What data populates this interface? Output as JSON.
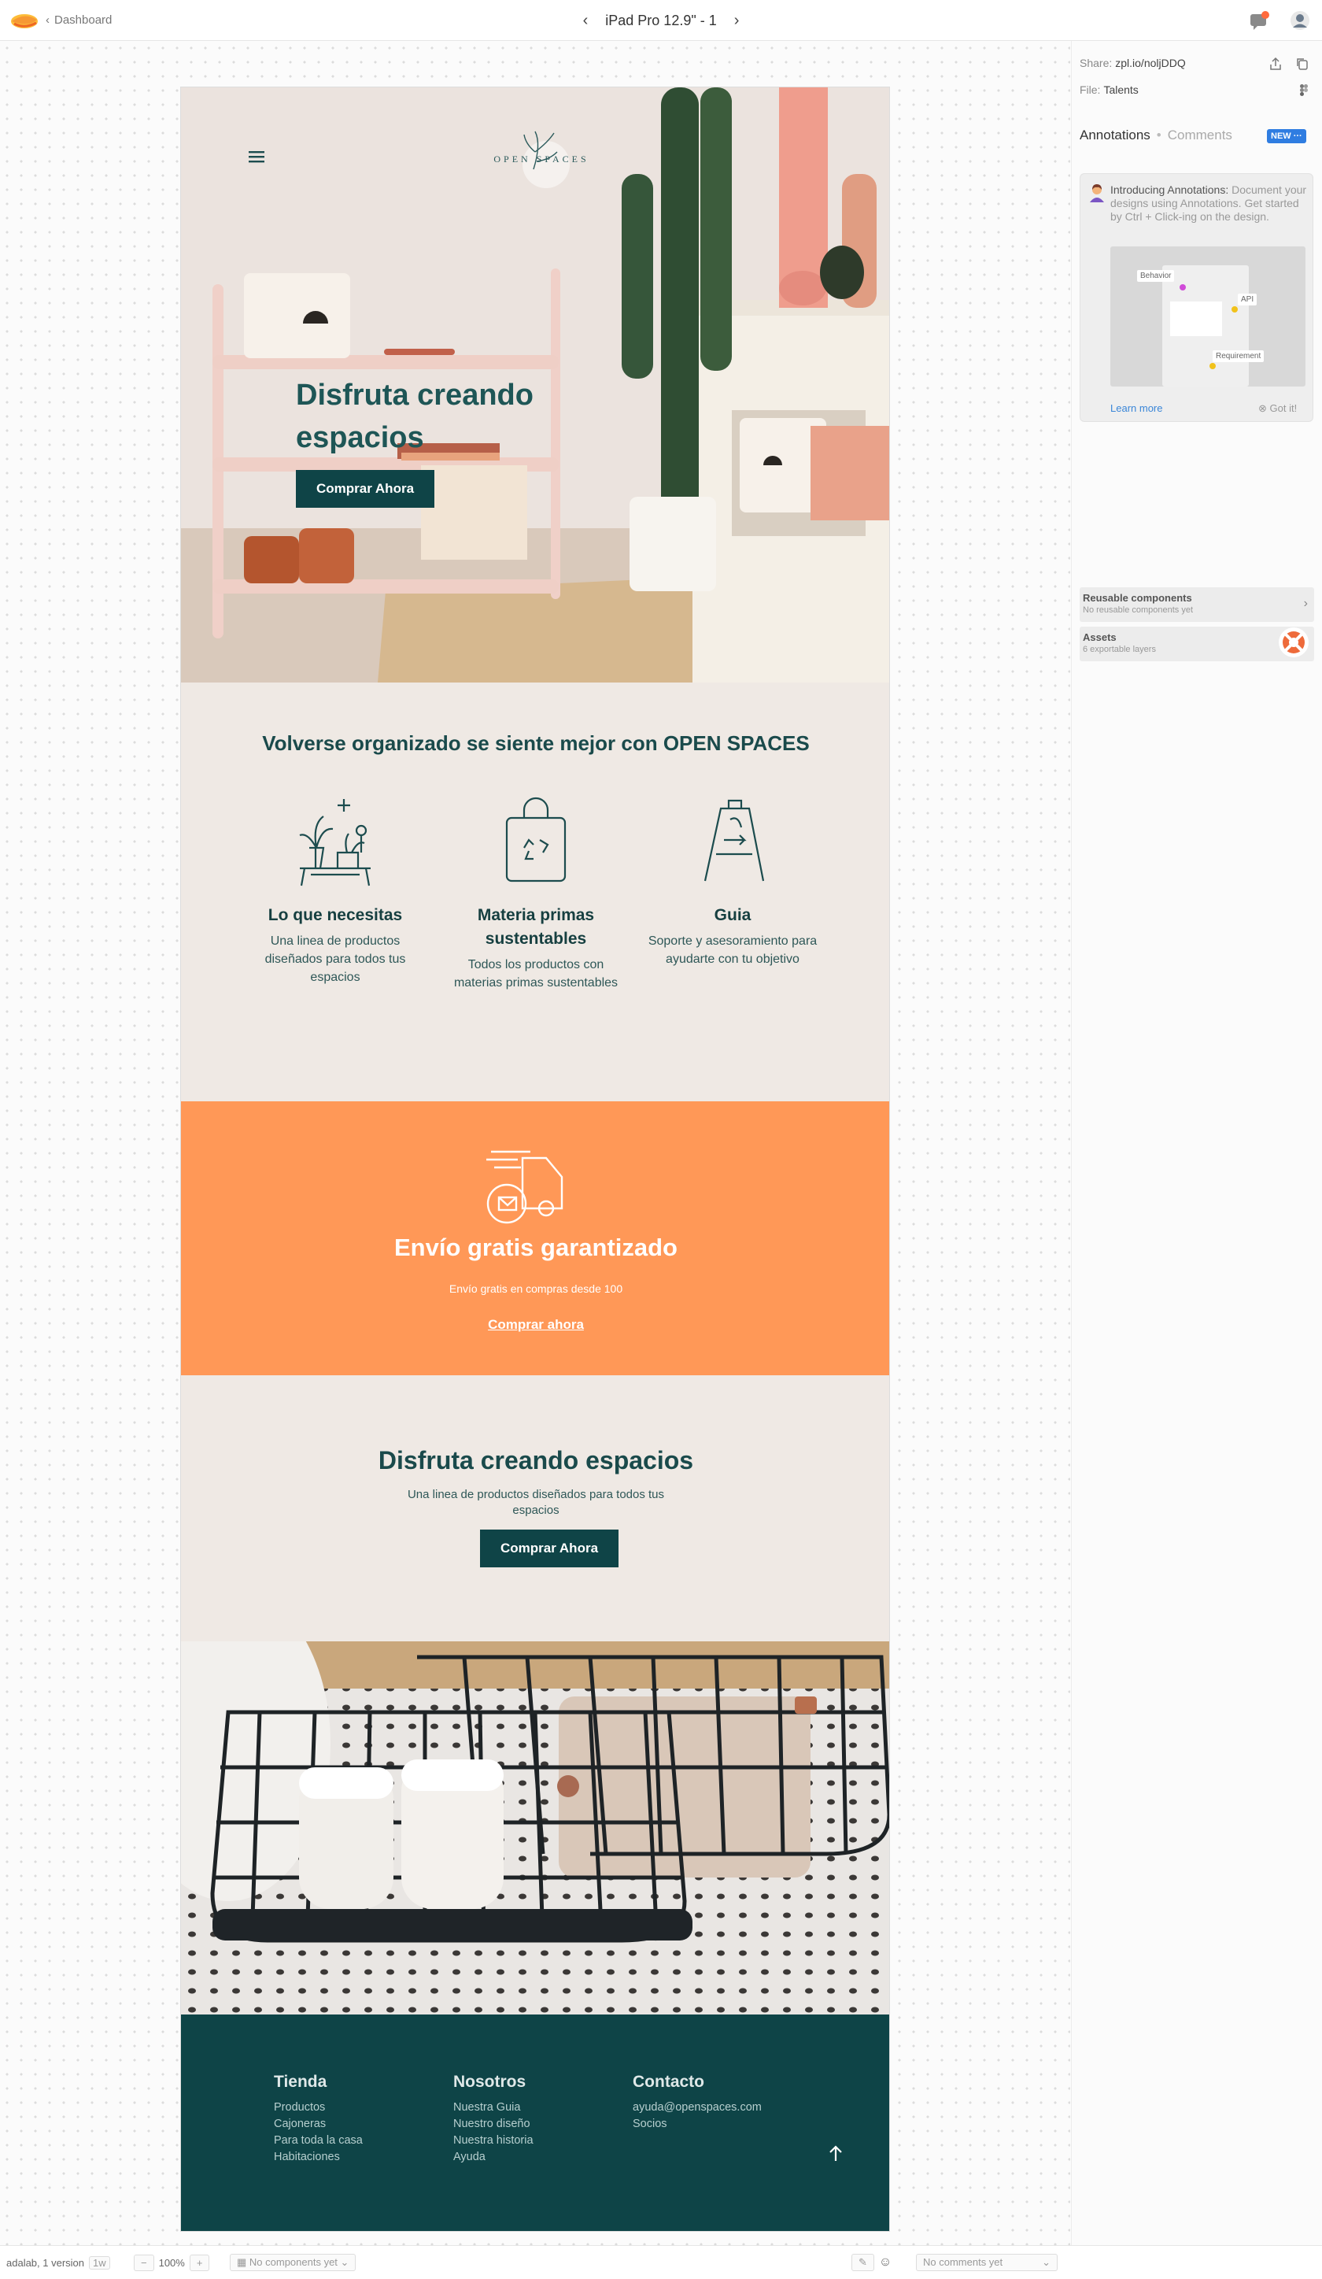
{
  "topbar": {
    "back_label": "Dashboard",
    "screen_name": "iPad Pro 12.9\" - 1"
  },
  "right_panel": {
    "share_label": "Share:",
    "share_url": "zpl.io/noljDDQ",
    "file_label": "File:",
    "file_name": "Talents",
    "tab_annotations": "Annotations",
    "tab_comments": "Comments",
    "new_badge": "NEW",
    "intro_title": "Introducing Annotations:",
    "intro_body": " Document your designs using Annotations. Get started by Ctrl + Click-ing on the design.",
    "illus_behavior": "Behavior",
    "illus_api": "API",
    "illus_requirement": "Requirement",
    "learn_more": "Learn more",
    "got_it": "Got it!",
    "reusable_title": "Reusable components",
    "reusable_sub": "No reusable components yet",
    "assets_title": "Assets",
    "assets_sub": "6 exportable layers"
  },
  "bottombar": {
    "version": "adalab, 1 version",
    "version_age": "1w",
    "zoom": "100%",
    "components": "No components yet",
    "comments": "No comments yet"
  },
  "artboard": {
    "logo_text": "OPEN SPACES",
    "hero": {
      "title": "Disfruta creando espacios",
      "button": "Comprar Ahora"
    },
    "organized": {
      "heading": "Volverse organizado se siente mejor con OPEN SPACES",
      "features": [
        {
          "title": "Lo que necesitas",
          "desc": "Una linea de productos diseñados para todos tus espacios"
        },
        {
          "title": "Materia primas sustentables",
          "desc": "Todos los productos con materias primas sustentables"
        },
        {
          "title": "Guia",
          "desc": "Soporte y asesoramiento para ayudarte con tu objetivo"
        }
      ]
    },
    "promo": {
      "title": "Envío gratis garantizado",
      "desc": "Envío gratis en compras desde 100",
      "link": "Comprar ahora"
    },
    "cta": {
      "title": "Disfruta creando espacios",
      "desc": "Una linea de productos diseñados para todos tus espacios",
      "button": "Comprar Ahora"
    },
    "footer": {
      "columns": [
        {
          "title": "Tienda",
          "items": [
            "Productos",
            "Cajoneras",
            "Para toda la casa",
            "Habitaciones"
          ]
        },
        {
          "title": "Nosotros",
          "items": [
            "Nuestra Guia",
            "Nuestro diseño",
            "Nuestra historia",
            "Ayuda"
          ]
        },
        {
          "title": "Contacto",
          "items": [
            "ayuda@openspaces.com",
            "Socios"
          ]
        }
      ]
    }
  },
  "colors": {
    "brand_dark": "#0e4447",
    "accent_orange": "#ff9857",
    "cream": "#efe9e4"
  }
}
